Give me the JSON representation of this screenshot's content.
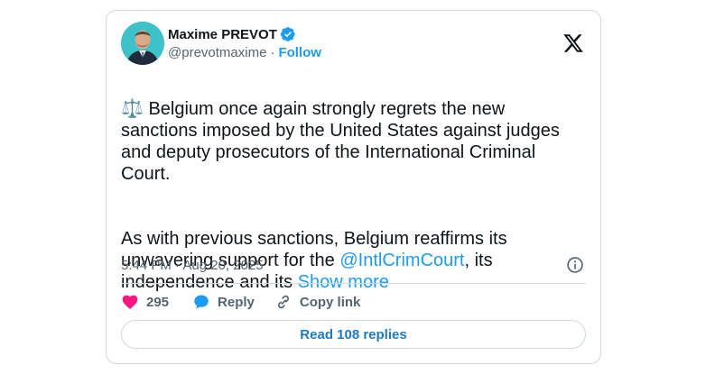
{
  "author": {
    "display_name": "Maxime PREVOT",
    "handle": "@prevotmaxime",
    "separator": "·",
    "follow_label": "Follow",
    "verified": true
  },
  "tweet": {
    "emoji": "⚖️",
    "paragraph1": " Belgium once again strongly regrets the new sanctions imposed by the United States against judges and deputy prosecutors of the International Criminal Court.",
    "paragraph2_start": "As with previous sanctions, Belgium reaffirms its unwavering support for the ",
    "mention": "@IntlCrimCourt",
    "paragraph2_end": ", its independence and its ",
    "show_more": "Show more"
  },
  "meta": {
    "time": "5:44 PM",
    "separator": " · ",
    "date": "Aug 20, 2025"
  },
  "actions": {
    "like_count": "295",
    "reply_label": "Reply",
    "copy_label": "Copy link"
  },
  "footer": {
    "read_replies_label": "Read 108 replies"
  },
  "colors": {
    "accent": "#1d9bf0",
    "like": "#f91880",
    "secondary_text": "#536471",
    "border": "#cfd9de"
  },
  "icons": [
    "verified-badge-icon",
    "x-logo-icon",
    "info-icon",
    "heart-icon",
    "reply-bubble-icon",
    "link-icon"
  ]
}
